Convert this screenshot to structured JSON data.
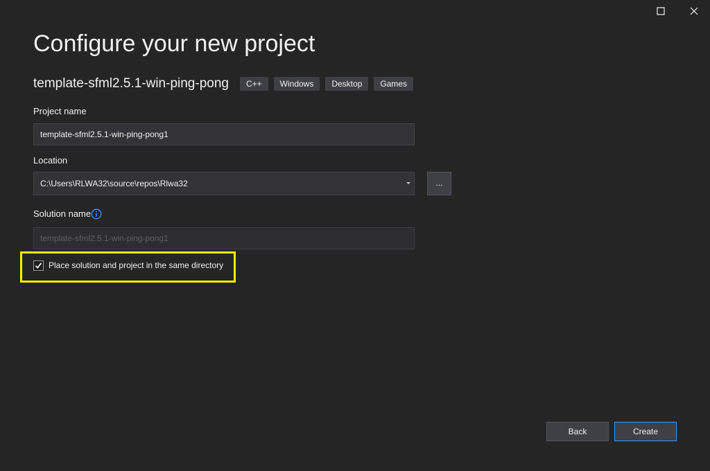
{
  "window": {
    "maximize_icon": "maximize-icon",
    "close_icon": "close-icon"
  },
  "page": {
    "title": "Configure your new project"
  },
  "template": {
    "name": "template-sfml2.5.1-win-ping-pong",
    "tags": [
      "C++",
      "Windows",
      "Desktop",
      "Games"
    ]
  },
  "form": {
    "project_name_label": "Project name",
    "project_name_value": "template-sfml2.5.1-win-ping-pong1",
    "location_label": "Location",
    "location_value": "C:\\Users\\RLWA32\\source\\repos\\Rlwa32",
    "browse_label": "...",
    "solution_name_label": "Solution name",
    "solution_name_value": "template-sfml2.5.1-win-ping-pong1",
    "same_directory_label": "Place solution and project in the same directory",
    "same_directory_checked": true
  },
  "footer": {
    "back_label": "Back",
    "create_label": "Create"
  },
  "colors": {
    "background": "#252526",
    "accent_border": "#3399ff",
    "highlight": "#f3f000",
    "info_icon": "#3794ff"
  }
}
